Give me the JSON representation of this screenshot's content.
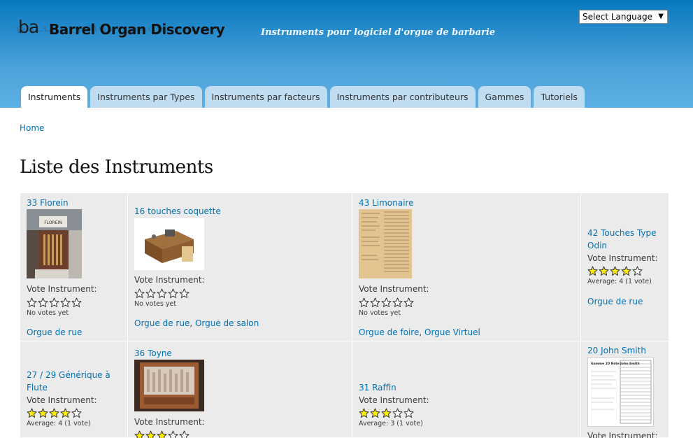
{
  "header": {
    "logo_mark": "ba",
    "site_name": "Barrel Organ Discovery",
    "slogan": "Instruments pour logiciel d'orgue de barbarie",
    "language_select": "Select Language"
  },
  "tabs": [
    {
      "label": "Instruments",
      "active": true
    },
    {
      "label": "Instruments par Types",
      "active": false
    },
    {
      "label": "Instruments par facteurs",
      "active": false
    },
    {
      "label": "Instruments par contributeurs",
      "active": false
    },
    {
      "label": "Gammes",
      "active": false
    },
    {
      "label": "Tutoriels",
      "active": false
    }
  ],
  "breadcrumb": "Home",
  "page_title": "Liste des Instruments",
  "vote_label": "Vote Instrument:",
  "colors": {
    "link": "#0071b3",
    "header_top": "#0779bf",
    "tab_bg": "#bfdcf1",
    "star_fill": "#ffeb00"
  },
  "instruments": [
    {
      "title": "33 Florein",
      "rating": 0,
      "vote_text": "No votes yet",
      "tags": [
        "Orgue de rue"
      ],
      "thumb": "photo-figure"
    },
    {
      "title": "16 touches coquette",
      "rating": 0,
      "vote_text": "No votes yet",
      "tags": [
        "Orgue de rue",
        "Orgue de salon"
      ],
      "thumb": "photo-box"
    },
    {
      "title": "43 Limonaire",
      "rating": 0,
      "vote_text": "No votes yet",
      "tags": [
        "Orgue de foire",
        "Orgue Virtuel"
      ],
      "thumb": "document"
    },
    {
      "title_line1": "42 Touches Type",
      "title_line2": "Odin",
      "rating": 4,
      "vote_text": "Average: 4 (1 vote)",
      "tags": [
        "Orgue de rue"
      ]
    },
    {
      "title_line1": "27 / 29 Générique à",
      "title_line2": "Flute",
      "rating": 4,
      "vote_text": "Average: 4 (1 vote)"
    },
    {
      "title": "36 Toyne",
      "rating": 3,
      "thumb": "photo-organ"
    },
    {
      "title": "31 Raffin",
      "rating": 3,
      "vote_text": "Average: 3 (1 vote)"
    },
    {
      "title": "20 John Smith",
      "thumb": "document-table",
      "thumb_text": "Gamme 20 Note John Smith"
    }
  ]
}
